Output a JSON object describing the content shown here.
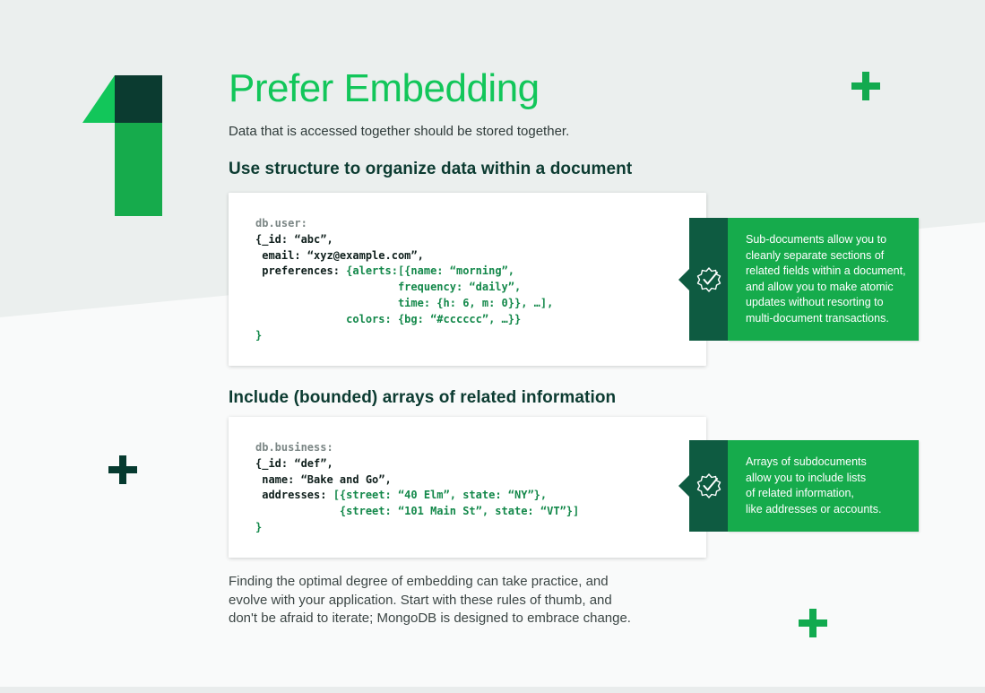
{
  "page": {
    "title": "Prefer Embedding",
    "subtitle": "Data that is accessed together should be stored together.",
    "accent_color": "#12c65a",
    "dark_color": "#063a2f"
  },
  "section1": {
    "heading": "Use structure to organize data within a document",
    "code_lines": [
      {
        "parts": [
          {
            "text": "db.user:",
            "style": "var"
          }
        ]
      },
      {
        "parts": [
          {
            "text": "{_id: “abc”,",
            "style": "plain"
          }
        ]
      },
      {
        "parts": [
          {
            "text": " email: “xyz@example.com”,",
            "style": "plain"
          }
        ]
      },
      {
        "parts": [
          {
            "text": " preferences: ",
            "style": "plain"
          },
          {
            "text": "{alerts:[{name: “morning”,",
            "style": "green"
          }
        ]
      },
      {
        "parts": [
          {
            "text": "                      frequency: “daily”,",
            "style": "green"
          }
        ]
      },
      {
        "parts": [
          {
            "text": "                      time: {h: 6, m: 0}}, …],",
            "style": "green"
          }
        ]
      },
      {
        "parts": [
          {
            "text": "              colors: {bg: “#cccccc”, …}}",
            "style": "green"
          }
        ]
      },
      {
        "parts": [
          {
            "text": "}",
            "style": "green"
          }
        ]
      }
    ],
    "callout_icon": "check-badge-icon",
    "callout_lines": [
      "Sub-documents allow you to",
      "cleanly separate sections of",
      "related fields within a document,",
      "and allow you to make atomic",
      "updates without resorting to",
      "multi-document transactions."
    ]
  },
  "section2": {
    "heading": "Include (bounded) arrays of related information",
    "code_lines": [
      {
        "parts": [
          {
            "text": "db.business:",
            "style": "var"
          }
        ]
      },
      {
        "parts": [
          {
            "text": "{_id: “def”,",
            "style": "plain"
          }
        ]
      },
      {
        "parts": [
          {
            "text": " name: “Bake and Go”,",
            "style": "plain"
          }
        ]
      },
      {
        "parts": [
          {
            "text": " addresses: ",
            "style": "plain"
          },
          {
            "text": "[{street: “40 Elm”, state: “NY”},",
            "style": "green"
          }
        ]
      },
      {
        "parts": [
          {
            "text": "             {street: “101 Main St”, state: “VT”}]",
            "style": "green"
          }
        ]
      },
      {
        "parts": [
          {
            "text": "}",
            "style": "green"
          }
        ]
      }
    ],
    "callout_icon": "check-badge-icon",
    "callout_lines": [
      "Arrays of subdocuments",
      "allow you to include lists",
      "of related information,",
      "like addresses or accounts."
    ]
  },
  "footer": {
    "lines": [
      "Finding the optimal degree of embedding can take practice, and",
      "evolve with your application. Start with these rules of thumb, and",
      "don't be afraid to iterate; MongoDB is designed to embrace change."
    ]
  }
}
